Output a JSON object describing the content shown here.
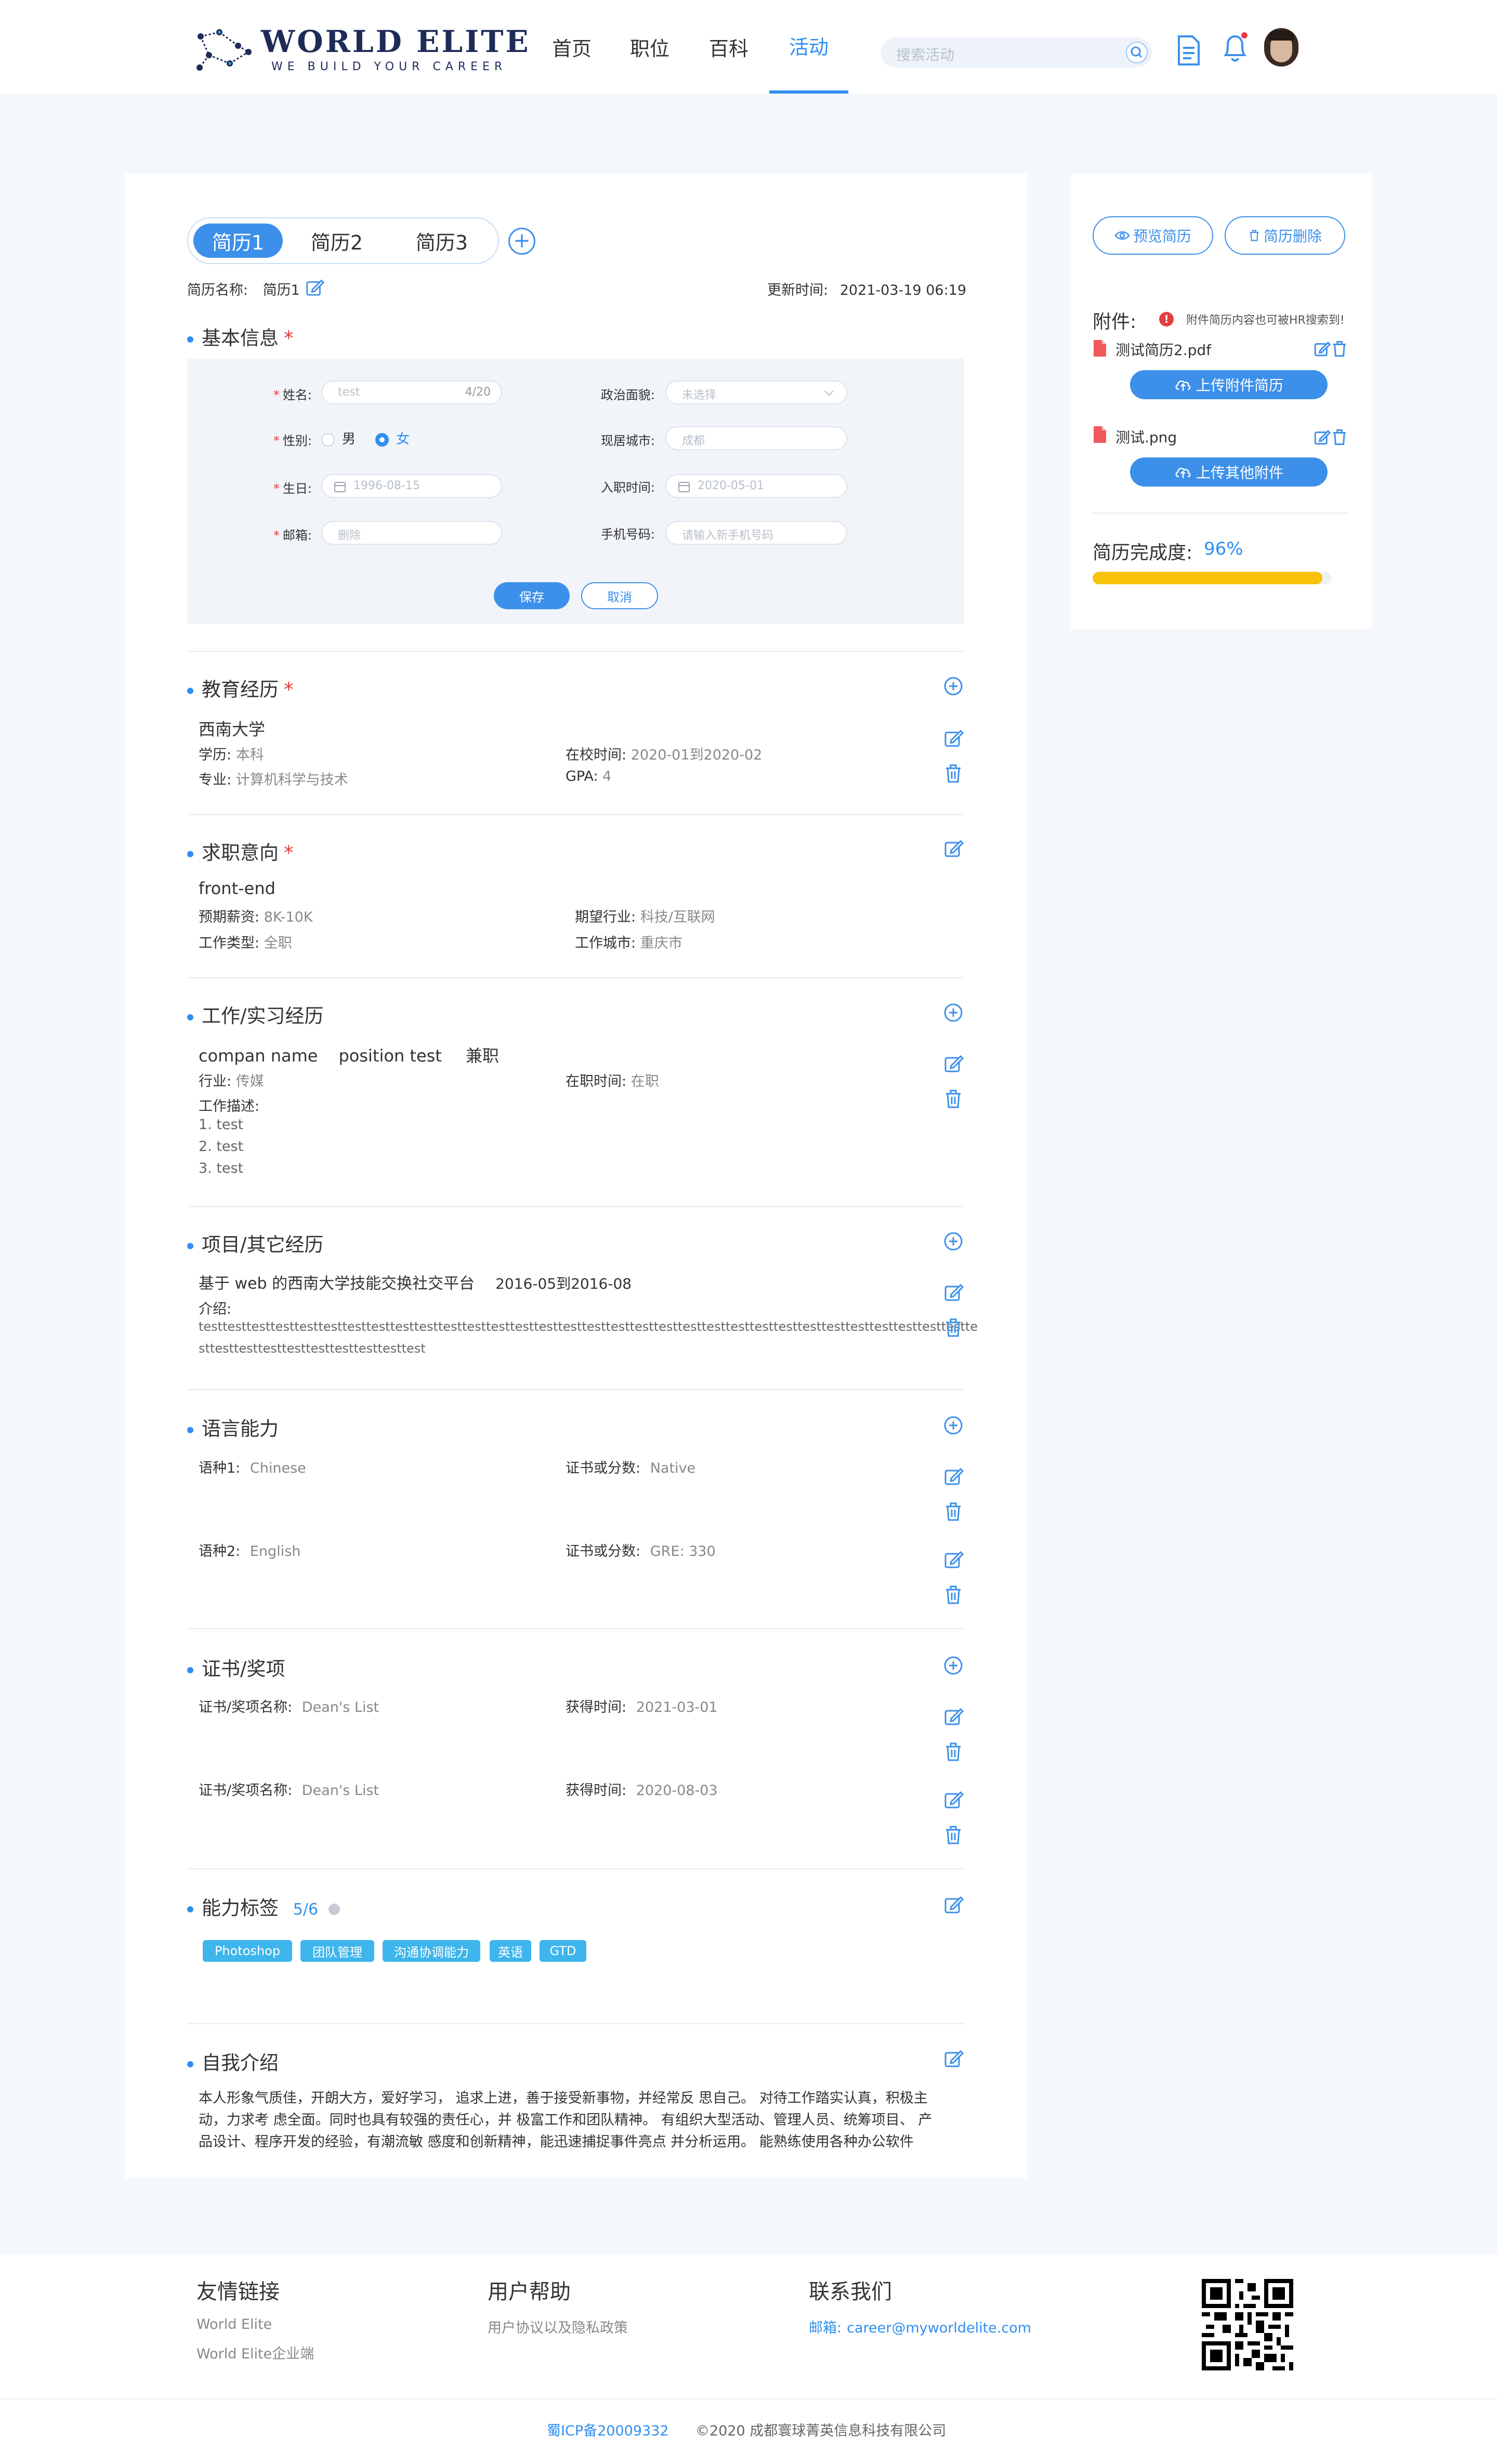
{
  "header": {
    "logo_title": "WORLD ELITE",
    "logo_subtitle": "WE BUILD YOUR CAREER",
    "nav": [
      "首页",
      "职位",
      "百科",
      "活动"
    ],
    "active_nav": "活动",
    "search_placeholder": "搜索活动"
  },
  "resume_tabs": [
    "简历1",
    "简历2",
    "简历3"
  ],
  "resume_meta": {
    "name_label": "简历名称:",
    "name_value": "简历1",
    "updated_label": "更新时间:",
    "updated_value": "2021-03-19 06:19"
  },
  "basic_info": {
    "title": "基本信息",
    "required_mark": "*",
    "name_label": "姓名:",
    "name_value": "test",
    "name_count": "4/20",
    "gender_label": "性别:",
    "gender_male": "男",
    "gender_female": "女",
    "birthday_label": "生日:",
    "birthday_value": "1996-08-15",
    "email_label": "邮箱:",
    "email_value": "删除",
    "politics_label": "政治面貌:",
    "politics_placeholder": "未选择",
    "city_label": "现居城市:",
    "city_value": "成都",
    "entry_label": "入职时间:",
    "entry_value": "2020-05-01",
    "phone_label": "手机号码:",
    "phone_placeholder": "请输入新手机号码",
    "save_label": "保存",
    "cancel_label": "取消"
  },
  "education": {
    "title": "教育经历",
    "required_mark": "*",
    "school": "西南大学",
    "degree_label": "学历:",
    "degree_value": "本科",
    "major_label": "专业:",
    "major_value": "计算机科学与技术",
    "period_label": "在校时间:",
    "period_value": "2020-01到2020-02",
    "gpa_label": "GPA:",
    "gpa_value": "4"
  },
  "intention": {
    "title": "求职意向",
    "required_mark": "*",
    "position": "front-end",
    "salary_label": "预期薪资:",
    "salary_value": "8K-10K",
    "jobtype_label": "工作类型:",
    "jobtype_value": "全职",
    "industry_label": "期望行业:",
    "industry_value": "科技/互联网",
    "city_label": "工作城市:",
    "city_value": "重庆市"
  },
  "work": {
    "title": "工作/实习经历",
    "company": "compan name",
    "position": "position test",
    "type": "兼职",
    "industry_label": "行业:",
    "industry_value": "传媒",
    "period_label": "在职时间:",
    "period_value": "在职",
    "desc_label": "工作描述:",
    "desc_lines": [
      "1. test",
      "2. test",
      "3. test"
    ]
  },
  "project": {
    "title": "项目/其它经历",
    "name": "基于 web 的西南大学技能交换社交平台",
    "period": "2016-05到2016-08",
    "intro_label": "介绍:",
    "intro_line1": "testtesttesttesttesttesttesttesttesttesttesttesttesttesttesttesttesttesttesttesttesttesttesttesttesttesttesttesttesttesttesttestte",
    "intro_line2": "sttesttesttesttesttesttesttesttesttest"
  },
  "language": {
    "title": "语言能力",
    "items": [
      {
        "label": "语种1:",
        "value": "Chinese",
        "cert_label": "证书或分数:",
        "cert_value": "Native"
      },
      {
        "label": "语种2:",
        "value": "English",
        "cert_label": "证书或分数:",
        "cert_value": "GRE: 330"
      }
    ]
  },
  "certificates": {
    "title": "证书/奖项",
    "items": [
      {
        "label": "证书/奖项名称:",
        "value": "Dean's List",
        "time_label": "获得时间:",
        "time_value": "2021-03-01"
      },
      {
        "label": "证书/奖项名称:",
        "value": "Dean's List",
        "time_label": "获得时间:",
        "time_value": "2020-08-03"
      }
    ]
  },
  "skills": {
    "title": "能力标签",
    "count": "5/6",
    "tags": [
      "Photoshop",
      "团队管理",
      "沟通协调能力",
      "英语",
      "GTD"
    ]
  },
  "intro": {
    "title": "自我介绍",
    "lines": [
      "本人形象气质佳，开朗大方，爱好学习， 追求上进，善于接受新事物，并经常反 思自己。 对待工作踏实认真，积极主",
      "动，力求考 虑全面。同时也具有较强的责任心，并 极富工作和团队精神。 有组织大型活动、管理人员、统筹项目、 产",
      "品设计、程序开发的经验，有潮流敏 感度和创新精神，能迅速捕捉事件亮点 并分析运用。 能熟练使用各种办公软件"
    ]
  },
  "sidebar": {
    "preview_label": "预览简历",
    "delete_label": "简历删除",
    "attach_title": "附件:",
    "attach_notice": "附件简历内容也可被HR搜索到!",
    "file1": "测试简历2.pdf",
    "upload_resume": "上传附件简历",
    "file2": "测试.png",
    "upload_other": "上传其他附件",
    "completion_label": "简历完成度:",
    "completion_value": "96%",
    "completion_fraction": 0.96
  },
  "footer": {
    "links_title": "友情链接",
    "links": [
      "World Elite",
      "World Elite企业端"
    ],
    "help_title": "用户帮助",
    "help_link": "用户协议以及隐私政策",
    "contact_title": "联系我们",
    "contact_label": "邮箱:",
    "contact_email": "career@myworldelite.com",
    "icp": "蜀ICP备20009332",
    "copyright": "©2020 成都寰球菁英信息科技有限公司"
  },
  "colors": {
    "accent": "#3d90ea",
    "required": "#e43d3d",
    "progress": "#f6c20a",
    "tag": "#3eb5ec"
  }
}
